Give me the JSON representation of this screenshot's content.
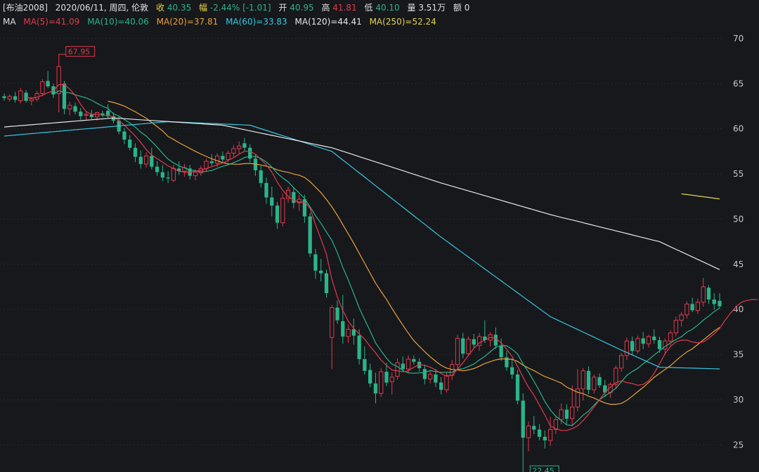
{
  "info": {
    "symbol": "[布油2008]",
    "date_label": "2020/06/11, 周四, 伦敦",
    "close_label": "收",
    "close": "40.35",
    "range_label": "幅",
    "range_pct": "-2.44%",
    "range_abs": "[-1.01]",
    "open_label": "开",
    "open": "40.95",
    "high_label": "高",
    "high": "41.81",
    "low_label": "低",
    "low": "40.10",
    "volume_label": "量",
    "volume": "3.51万",
    "amount_label": "额",
    "amount": "0"
  },
  "ma_legend": {
    "title": "MA",
    "ma5": "MA(5)=41.09",
    "ma10": "MA(10)=40.06",
    "ma20": "MA(20)=37.81",
    "ma60": "MA(60)=33.83",
    "ma120": "MA(120)=44.41",
    "ma250": "MA(250)=52.24"
  },
  "colors": {
    "up": "#e23a4b",
    "down": "#2bb48a",
    "ma5": "#e23a4b",
    "ma10": "#2bb48a",
    "ma20": "#e9a23b",
    "ma60": "#3ac8e0",
    "ma120": "#e8e8e8",
    "ma250": "#e6d34a",
    "grid": "#262a30",
    "axis_text": "#c8c8c8"
  },
  "chart_data": {
    "type": "candlestick",
    "ylim": [
      22,
      71
    ],
    "yticks": [
      25,
      30,
      35,
      40,
      45,
      50,
      55,
      60,
      65,
      70
    ],
    "annotations": {
      "max_label": "67.95",
      "min_label": "22.45"
    },
    "candles": [
      [
        63.6,
        63.9,
        63.1,
        63.4
      ],
      [
        63.3,
        63.8,
        63.0,
        63.6
      ],
      [
        63.6,
        64.1,
        62.9,
        63.2
      ],
      [
        63.1,
        64.5,
        62.8,
        64.2
      ],
      [
        64.0,
        64.3,
        62.9,
        63.1
      ],
      [
        63.1,
        63.5,
        62.6,
        63.3
      ],
      [
        63.3,
        64.2,
        63.0,
        63.9
      ],
      [
        63.9,
        65.5,
        63.6,
        65.2
      ],
      [
        65.3,
        66.4,
        64.5,
        64.7
      ],
      [
        64.7,
        65.0,
        63.4,
        63.8
      ],
      [
        63.9,
        67.95,
        61.8,
        66.9
      ],
      [
        65.0,
        65.3,
        61.6,
        62.2
      ],
      [
        62.2,
        63.0,
        61.5,
        62.6
      ],
      [
        62.5,
        62.9,
        61.6,
        61.9
      ],
      [
        61.9,
        62.3,
        61.0,
        61.4
      ],
      [
        61.5,
        62.0,
        60.9,
        61.6
      ],
      [
        61.6,
        62.1,
        61.0,
        61.3
      ],
      [
        61.3,
        61.9,
        60.9,
        61.8
      ],
      [
        61.7,
        62.0,
        61.3,
        61.5
      ],
      [
        62.0,
        62.7,
        61.1,
        61.4
      ],
      [
        61.4,
        61.8,
        60.6,
        60.9
      ],
      [
        60.9,
        61.4,
        59.4,
        59.7
      ],
      [
        59.7,
        60.1,
        58.3,
        58.8
      ],
      [
        58.8,
        59.3,
        57.6,
        57.9
      ],
      [
        57.9,
        58.4,
        56.3,
        56.9
      ],
      [
        56.9,
        57.6,
        55.6,
        56.1
      ],
      [
        56.1,
        57.4,
        55.7,
        57.0
      ],
      [
        57.0,
        57.9,
        55.5,
        55.8
      ],
      [
        55.8,
        56.4,
        54.8,
        55.2
      ],
      [
        55.2,
        56.0,
        54.2,
        54.6
      ],
      [
        54.6,
        55.3,
        54.0,
        54.5
      ],
      [
        54.3,
        56.0,
        54.1,
        55.6
      ],
      [
        55.6,
        56.4,
        54.9,
        55.3
      ],
      [
        55.3,
        56.1,
        54.7,
        55.7
      ],
      [
        55.6,
        56.0,
        54.4,
        54.8
      ],
      [
        54.8,
        55.5,
        54.3,
        55.2
      ],
      [
        55.1,
        55.9,
        54.8,
        55.6
      ],
      [
        55.6,
        56.7,
        55.3,
        56.4
      ],
      [
        56.4,
        57.2,
        55.9,
        56.2
      ],
      [
        56.2,
        57.3,
        55.8,
        57.0
      ],
      [
        57.0,
        57.5,
        56.3,
        56.6
      ],
      [
        56.6,
        57.6,
        56.3,
        57.3
      ],
      [
        57.3,
        58.2,
        56.9,
        57.8
      ],
      [
        57.8,
        58.6,
        57.2,
        58.1
      ],
      [
        58.4,
        59.0,
        57.5,
        57.9
      ],
      [
        57.9,
        58.3,
        56.3,
        56.7
      ],
      [
        56.7,
        57.1,
        54.8,
        55.4
      ],
      [
        55.4,
        55.9,
        53.5,
        54.0
      ],
      [
        54.0,
        54.6,
        51.7,
        52.4
      ],
      [
        52.4,
        53.6,
        50.3,
        51.5
      ],
      [
        51.5,
        51.9,
        48.9,
        49.6
      ],
      [
        49.6,
        52.8,
        49.2,
        52.3
      ],
      [
        52.3,
        53.6,
        51.8,
        53.2
      ],
      [
        53.0,
        53.5,
        51.2,
        51.8
      ],
      [
        51.8,
        52.7,
        50.9,
        52.2
      ],
      [
        52.2,
        52.7,
        49.6,
        50.3
      ],
      [
        50.3,
        50.7,
        45.8,
        46.2
      ],
      [
        46.1,
        46.7,
        43.4,
        44.3
      ],
      [
        44.3,
        45.6,
        43.1,
        44.0
      ],
      [
        44.0,
        44.4,
        41.3,
        41.8
      ],
      [
        36.9,
        40.5,
        33.4,
        40.2
      ],
      [
        40.2,
        41.0,
        38.4,
        38.8
      ],
      [
        38.7,
        41.6,
        36.2,
        37.0
      ],
      [
        37.0,
        38.3,
        36.3,
        37.8
      ],
      [
        37.8,
        39.0,
        36.1,
        37.1
      ],
      [
        37.1,
        37.8,
        33.9,
        34.5
      ],
      [
        34.5,
        35.9,
        32.8,
        33.2
      ],
      [
        33.3,
        34.0,
        31.4,
        31.8
      ],
      [
        31.8,
        33.0,
        29.6,
        30.7
      ],
      [
        30.7,
        33.5,
        30.3,
        33.1
      ],
      [
        33.1,
        34.1,
        31.5,
        31.9
      ],
      [
        32.0,
        33.0,
        30.6,
        32.5
      ],
      [
        32.6,
        34.6,
        32.2,
        34.1
      ],
      [
        34.0,
        34.8,
        33.1,
        33.4
      ],
      [
        33.4,
        34.9,
        33.0,
        34.5
      ],
      [
        34.5,
        34.9,
        33.9,
        34.2
      ],
      [
        34.2,
        34.6,
        33.1,
        33.5
      ],
      [
        33.4,
        33.9,
        31.7,
        32.3
      ],
      [
        32.3,
        33.2,
        31.8,
        32.8
      ],
      [
        32.8,
        33.4,
        31.4,
        31.9
      ],
      [
        31.9,
        32.5,
        30.6,
        31.1
      ],
      [
        31.1,
        33.1,
        30.8,
        32.7
      ],
      [
        32.7,
        34.4,
        32.2,
        33.9
      ],
      [
        33.9,
        37.2,
        33.5,
        36.8
      ],
      [
        36.8,
        37.4,
        34.6,
        35.1
      ],
      [
        35.1,
        37.0,
        34.9,
        36.7
      ],
      [
        36.7,
        37.3,
        35.7,
        36.1
      ],
      [
        36.0,
        37.4,
        35.4,
        37.0
      ],
      [
        37.0,
        38.8,
        36.3,
        36.6
      ],
      [
        36.6,
        37.5,
        35.9,
        37.2
      ],
      [
        37.2,
        38.0,
        35.6,
        36.0
      ],
      [
        36.0,
        36.8,
        34.3,
        34.7
      ],
      [
        34.7,
        35.4,
        33.2,
        33.6
      ],
      [
        33.6,
        34.6,
        32.3,
        32.8
      ],
      [
        32.8,
        33.3,
        29.5,
        29.9
      ],
      [
        29.9,
        30.7,
        22.45,
        25.8
      ],
      [
        25.8,
        27.6,
        24.3,
        27.1
      ],
      [
        27.1,
        28.2,
        26.2,
        26.7
      ],
      [
        26.7,
        27.3,
        25.5,
        25.9
      ],
      [
        25.9,
        26.6,
        24.6,
        25.5
      ],
      [
        25.5,
        28.1,
        24.9,
        26.7
      ],
      [
        26.7,
        28.3,
        26.2,
        27.8
      ],
      [
        27.8,
        29.6,
        27.3,
        28.9
      ],
      [
        28.9,
        29.5,
        27.3,
        27.9
      ],
      [
        27.9,
        31.6,
        27.1,
        29.2
      ],
      [
        29.2,
        33.4,
        28.7,
        31.2
      ],
      [
        31.2,
        33.5,
        29.9,
        33.2
      ],
      [
        33.2,
        33.7,
        30.6,
        31.1
      ],
      [
        31.1,
        32.8,
        30.7,
        32.5
      ],
      [
        32.5,
        32.9,
        31.3,
        31.6
      ],
      [
        31.6,
        32.2,
        30.3,
        30.8
      ],
      [
        30.8,
        31.9,
        30.2,
        31.7
      ],
      [
        31.7,
        33.8,
        31.2,
        33.5
      ],
      [
        33.5,
        35.2,
        33.1,
        34.9
      ],
      [
        34.9,
        36.9,
        34.4,
        36.5
      ],
      [
        36.5,
        37.0,
        35.0,
        35.4
      ],
      [
        35.4,
        37.1,
        35.1,
        36.8
      ],
      [
        36.8,
        37.5,
        35.6,
        36.2
      ],
      [
        36.2,
        37.2,
        35.8,
        37.0
      ],
      [
        37.0,
        37.8,
        36.2,
        36.6
      ],
      [
        36.6,
        37.0,
        35.2,
        35.6
      ],
      [
        35.6,
        36.8,
        35.0,
        36.5
      ],
      [
        36.5,
        37.7,
        36.0,
        37.4
      ],
      [
        37.4,
        39.2,
        37.0,
        38.8
      ],
      [
        38.8,
        39.7,
        38.1,
        39.4
      ],
      [
        39.4,
        40.9,
        39.0,
        40.6
      ],
      [
        40.6,
        41.3,
        39.7,
        39.9
      ],
      [
        39.9,
        41.2,
        39.5,
        40.8
      ],
      [
        40.8,
        43.5,
        40.3,
        42.5
      ],
      [
        42.4,
        42.7,
        40.6,
        41.1
      ],
      [
        41.1,
        41.8,
        40.0,
        40.6
      ],
      [
        40.95,
        41.81,
        40.1,
        40.35
      ]
    ],
    "ma_series": {
      "ma5": [
        null,
        null,
        null,
        null,
        63.5,
        63.4,
        63.5,
        63.7,
        64.0,
        64.2,
        64.9,
        64.9,
        64.4,
        63.7,
        62.7,
        61.9,
        61.6,
        61.6,
        61.5,
        61.5,
        61.3,
        60.9,
        60.4,
        59.8,
        59.2,
        58.5,
        57.7,
        57.1,
        56.7,
        56.3,
        55.9,
        55.6,
        55.3,
        55.2,
        55.2,
        55.3,
        55.4,
        55.6,
        55.8,
        56.0,
        56.2,
        56.5,
        56.8,
        57.2,
        57.5,
        57.5,
        57.2,
        56.6,
        56.0,
        55.2,
        54.1,
        53.2,
        52.5,
        52.1,
        51.9,
        51.9,
        51.2,
        49.4,
        47.8,
        46.1,
        43.3,
        41.4,
        39.9,
        38.7,
        37.9,
        37.3,
        36.7,
        35.9,
        35.2,
        34.4,
        33.8,
        33.3,
        33.2,
        33.1,
        33.2,
        33.6,
        33.9,
        33.8,
        33.6,
        33.3,
        32.9,
        32.6,
        32.7,
        33.4,
        34.1,
        34.9,
        35.7,
        36.3,
        36.6,
        36.9,
        36.8,
        36.3,
        35.6,
        34.8,
        33.7,
        32.5,
        31.4,
        30.5,
        29.4,
        28.3,
        27.1,
        26.8,
        26.6,
        26.6,
        26.8,
        27.1,
        27.7,
        28.4,
        29.2,
        30.0,
        30.8,
        31.4,
        31.9,
        32.1,
        31.9,
        31.8,
        31.6,
        31.7,
        32.1,
        32.9,
        34.0,
        35.1,
        35.9,
        36.4,
        36.6,
        36.6,
        36.4,
        36.3,
        36.4,
        36.8,
        37.3,
        37.9,
        38.8,
        39.6,
        40.3,
        40.8,
        41.0,
        41.1,
        41.09
      ]
    }
  }
}
